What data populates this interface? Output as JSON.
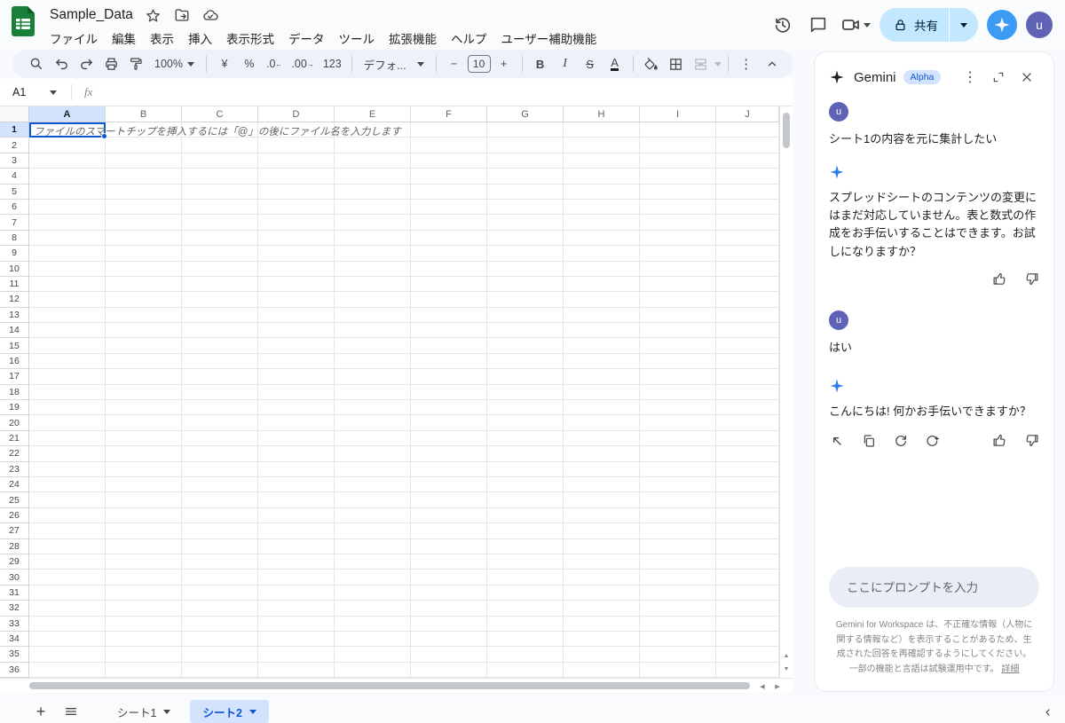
{
  "app": {
    "title": "Sample_Data"
  },
  "menu_bar": {
    "items": [
      "ファイル",
      "編集",
      "表示",
      "挿入",
      "表示形式",
      "データ",
      "ツール",
      "拡張機能",
      "ヘルプ",
      "ユーザー補助機能"
    ]
  },
  "topbar": {
    "share_label": "共有",
    "avatar_initial": "u"
  },
  "toolbar": {
    "zoom": "100%",
    "currency": "¥",
    "percent": "%",
    "decrease_decimal": ".0",
    "increase_decimal": ".00",
    "number_format": "123",
    "font_name": "デフォ...",
    "font_size": "10",
    "bold": "B",
    "italic": "I",
    "strike": "S",
    "text_color": "A",
    "minus": "−",
    "plus": "+",
    "more": "⋮"
  },
  "formula_bar": {
    "cell_ref": "A1",
    "fx": "fx"
  },
  "grid": {
    "columns": [
      "A",
      "B",
      "C",
      "D",
      "E",
      "F",
      "G",
      "H",
      "I",
      "J"
    ],
    "row_count": 36,
    "active_cell": "A1",
    "active_cell_placeholder": "ファイルのスマートチップを挿入するには「@」の後にファイル名を入力します"
  },
  "sheet_tabs": {
    "add": "+",
    "tabs": [
      {
        "label": "シート1",
        "active": false
      },
      {
        "label": "シート2",
        "active": true
      }
    ]
  },
  "gemini": {
    "title": "Gemini",
    "badge": "Alpha",
    "user_initial": "u",
    "messages": [
      {
        "role": "user",
        "text": "シート1の内容を元に集計したい"
      },
      {
        "role": "gemini",
        "text": "スプレッドシートのコンテンツの変更にはまだ対応していません。表と数式の作成をお手伝いすることはできます。お試しになりますか？"
      },
      {
        "role": "user",
        "text": "はい"
      },
      {
        "role": "gemini",
        "text": "こんにちは! 何かお手伝いできますか？"
      }
    ],
    "input_placeholder": "ここにプロンプトを入力",
    "disclaimer": "Gemini for Workspace は、不正確な情報（人物に関する情報など）を表示することがあるため、生成された回答を再確認するようにしてください。一部の機能と言語は試験運用中です。",
    "disclaimer_link": "詳細"
  },
  "colors": {
    "accent_blue": "#0b57d0",
    "selection_bg": "#d3e3fd",
    "share_pill_bg": "#c2e7ff",
    "gemini_button_bg": "#3c9af5",
    "avatar_bg": "#5e63b6",
    "toolbar_bg": "#edf2fa",
    "topbar_bg": "#f9fbfd",
    "sheets_green": "#188038"
  }
}
